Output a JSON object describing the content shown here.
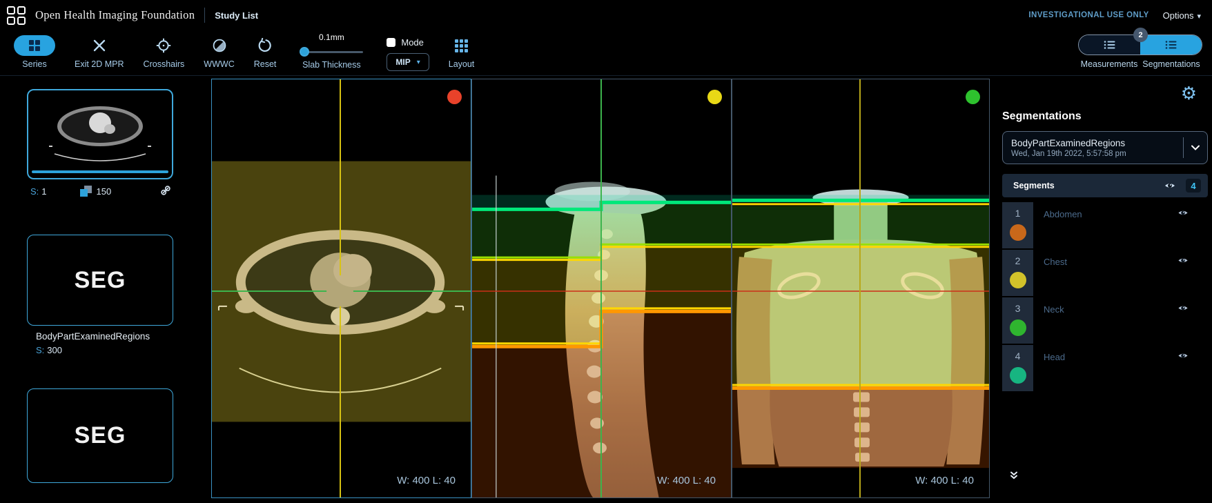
{
  "header": {
    "app_title": "Open Health Imaging Foundation",
    "study_list": "Study List",
    "investigational": "INVESTIGATIONAL USE ONLY",
    "options_label": "Options",
    "options_caret": "▾"
  },
  "toolbar": {
    "tools": [
      {
        "label": "Series"
      },
      {
        "label": "Exit 2D MPR"
      },
      {
        "label": "Crosshairs"
      },
      {
        "label": "WWWC"
      },
      {
        "label": "Reset"
      }
    ],
    "slab_thickness": {
      "value": "0.1mm",
      "label": "Slab Thickness"
    },
    "mode": {
      "label": "Mode",
      "selected": "MIP",
      "caret": "▾"
    },
    "layout": {
      "label": "Layout"
    },
    "panel_tabs": {
      "measurements_label": "Measurements",
      "segmentations_label": "Segmentations",
      "badge_count": "2"
    }
  },
  "sidebar": {
    "thumbnails": [
      {
        "series_prefix": "S:",
        "series_number": "1",
        "instance_count": "150"
      },
      {
        "modality": "SEG",
        "description": "BodyPartExaminedRegions",
        "series_prefix": "S:",
        "series_number": "300"
      },
      {
        "modality": "SEG"
      }
    ]
  },
  "viewports": [
    {
      "window_level": "W: 400 L: 40",
      "marker_color": "#e8422a"
    },
    {
      "window_level": "W: 400 L: 40",
      "marker_color": "#e8d816"
    },
    {
      "window_level": "W: 400 L: 40",
      "marker_color": "#2ec22e"
    }
  ],
  "segmentation_panel": {
    "title": "Segmentations",
    "active_segmentation": {
      "name": "BodyPartExaminedRegions",
      "date": "Wed, Jan 19th 2022, 5:57:58 pm"
    },
    "segments_header": {
      "label": "Segments",
      "count": "4"
    },
    "segments": [
      {
        "number": "1",
        "label": "Abdomen",
        "color": "#c9681a"
      },
      {
        "number": "2",
        "label": "Chest",
        "color": "#d2c22a"
      },
      {
        "number": "3",
        "label": "Neck",
        "color": "#2fb52f"
      },
      {
        "number": "4",
        "label": "Head",
        "color": "#17b581"
      }
    ]
  },
  "colors": {
    "accent_blue": "#28a3e0",
    "active_viewport_border": "#3a93c4",
    "segment_line_head": "#00e87a",
    "segment_line_neck": "#9ae000",
    "segment_line_chest": "#ff9800",
    "crosshair_axial": "#d8c313",
    "crosshair_sagittal": "#3db44d",
    "reference_line_red": "#cc2f18"
  }
}
